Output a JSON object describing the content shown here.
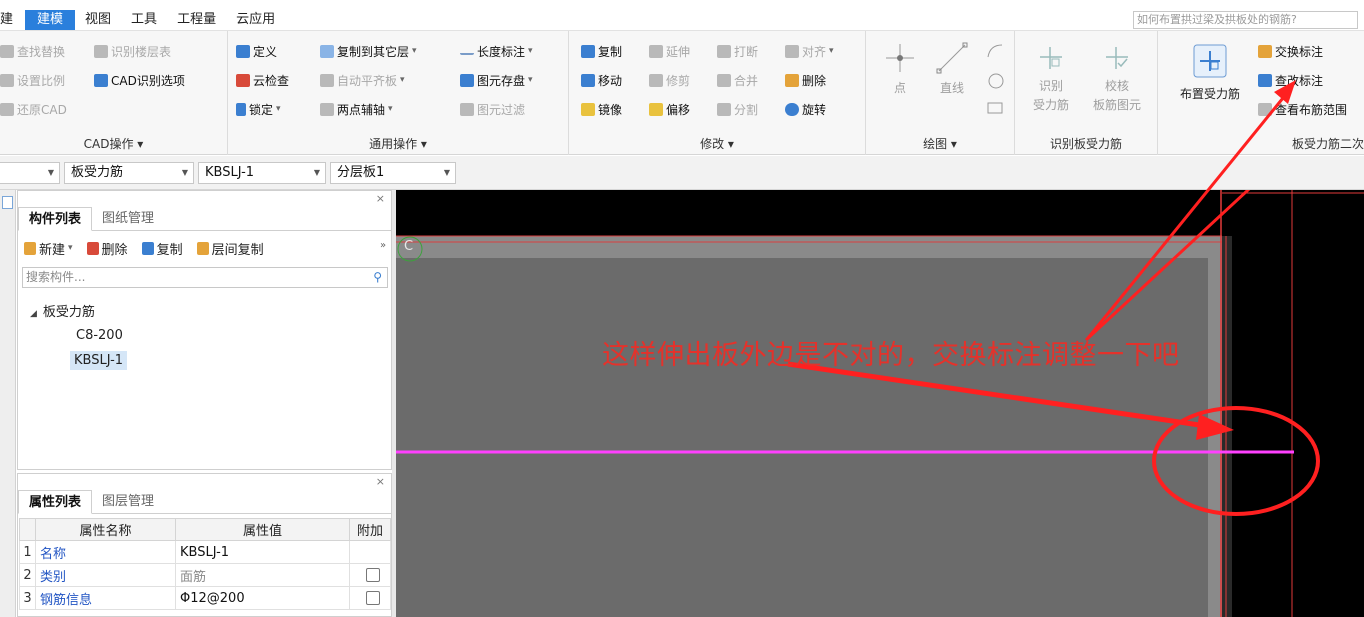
{
  "menu": {
    "tabs": [
      "建模",
      "视图",
      "工具",
      "工程量",
      "云应用"
    ],
    "first_tab": "建",
    "active_index": 0,
    "search_placeholder": "如何布置拱过梁及拱板处的钢筋?"
  },
  "ribbon": {
    "cad_group": {
      "title": "CAD操作 ▾",
      "buttons": [
        "查找替换",
        "识别楼层表",
        "设置比例",
        "CAD识别选项",
        "还原CAD"
      ]
    },
    "common_group": {
      "title": "通用操作 ▾",
      "buttons": [
        "定义",
        "复制到其它层",
        "长度标注",
        "云检查",
        "自动平齐板",
        "图元存盘",
        "锁定",
        "两点辅轴",
        "图元过滤"
      ]
    },
    "modify_group": {
      "title": "修改 ▾",
      "buttons": [
        "复制",
        "延伸",
        "打断",
        "对齐",
        "移动",
        "修剪",
        "合并",
        "删除",
        "镜像",
        "偏移",
        "分割",
        "旋转"
      ]
    },
    "draw_group": {
      "title": "绘图 ▾",
      "buttons": [
        "点",
        "直线"
      ]
    },
    "identify_group": {
      "title": "识别板受力筋",
      "buttons": [
        "识别\n受力筋",
        "校核\n板筋图元"
      ]
    },
    "slab_group": {
      "title": "板受力筋二次",
      "big_button": "布置受力筋",
      "buttons": [
        "交换标注",
        "查改标注",
        "查看布筋范围"
      ]
    }
  },
  "filters": {
    "dropdowns": [
      "",
      "板受力筋",
      "KBSLJ-1",
      "分层板1"
    ]
  },
  "component_panel": {
    "tabs": [
      "构件列表",
      "图纸管理"
    ],
    "toolbar": [
      "新建",
      "删除",
      "复制",
      "层间复制"
    ],
    "search_placeholder": "搜索构件...",
    "tree": {
      "root": "板受力筋",
      "children": [
        "C8-200",
        "KBSLJ-1"
      ],
      "selected": "KBSLJ-1"
    }
  },
  "property_panel": {
    "tabs": [
      "属性列表",
      "图层管理"
    ],
    "headers": [
      "属性名称",
      "属性值",
      "附加"
    ],
    "rows": [
      {
        "num": "1",
        "name": "名称",
        "value": "KBSLJ-1",
        "checkbox": false
      },
      {
        "num": "2",
        "name": "类别",
        "value": "面筋",
        "checkbox": true
      },
      {
        "num": "3",
        "name": "钢筋信息",
        "value": "Φ12@200",
        "checkbox": true
      }
    ]
  },
  "canvas": {
    "axis_label": "C",
    "annotation": "这样伸出板外边是不对的，交换标注调整一下吧",
    "colors": {
      "background": "#000000",
      "slab": "#6b6b6b",
      "rebar": "#ff40ff",
      "annotation": "#e4322b",
      "axis": "#3ba33b"
    }
  }
}
